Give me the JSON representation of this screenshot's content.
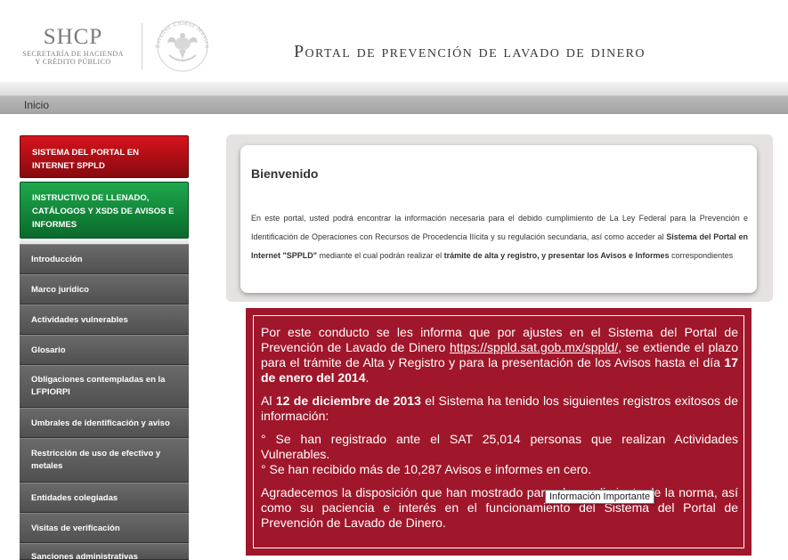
{
  "header": {
    "logo_acronym": "SHCP",
    "logo_line1": "Secretaría de Hacienda",
    "logo_line2": "y Crédito Público",
    "seal_text": "Estados Unidos Mexicanos",
    "portal_title": "Portal de prevención de lavado de dinero"
  },
  "breadcrumb": {
    "home": "Inicio"
  },
  "sidebar": {
    "red_button": "SISTEMA DEL PORTAL EN INTERNET SPPLD",
    "green_button": "INSTRUCTIVO DE LLENADO, CATÁLOGOS Y XSDs DE AVISOS E INFORMES",
    "items": [
      {
        "label": "Introducción"
      },
      {
        "label": "Marco jurídico"
      },
      {
        "label": "Actividades vulnerables"
      },
      {
        "label": "Glosario"
      },
      {
        "label": "Obligaciones contempladas en la LFPIORPI"
      },
      {
        "label": "Umbrales de identificación y aviso"
      },
      {
        "label": "Restricción de uso de efectivo y metales"
      },
      {
        "label": "Entidades colegiadas"
      },
      {
        "label": "Visitas de verificación"
      },
      {
        "label": "Sanciones administrativas"
      }
    ]
  },
  "welcome": {
    "title": "Bienvenido",
    "text_part1": "En este portal, usted podrá encontrar la información necesaria para el debido cumplimiento de La Ley Federal para la Prevención e Identificación de Operaciones con Recursos de Procedencia Ilícita y su regulación secundaria, así como acceder al ",
    "text_bold1": "Sistema del Portal en Internet \"SPPLD\"",
    "text_part2": " mediante el cual podrán realizar el ",
    "text_bold2": "trámite de alta y registro, y presentar los Avisos e Informes",
    "text_part3": " correspondientes"
  },
  "notice": {
    "p1_text1": "Por este conducto se les informa que por ajustes en el Sistema del Portal de Prevención de Lavado de Dinero ",
    "p1_link": "https://sppld.sat.gob.mx/sppld/",
    "p1_text2": ", se extiende el plazo para el trámite de Alta y Registro y para la presentación de los Avisos hasta el día ",
    "p1_bold": "17 de enero del 2014",
    "p1_end": ".",
    "p2_text1": "Al ",
    "p2_bold": "12 de diciembre de 2013",
    "p2_text2": " el Sistema ha tenido los siguientes registros exitosos de información:",
    "bullet1": "° Se han registrado ante el SAT 25,014 personas que realizan Actividades Vulnerables.",
    "bullet2": "° Se han recibido más de 10,287 Avisos e informes en cero.",
    "p4": "Agradecemos la disposición que han mostrado para el cumplimiento de la norma, así como su paciencia e interés en el funcionamiento del Sistema del Portal de Prevención de Lavado de Dinero.",
    "tooltip": "Información Importante"
  }
}
